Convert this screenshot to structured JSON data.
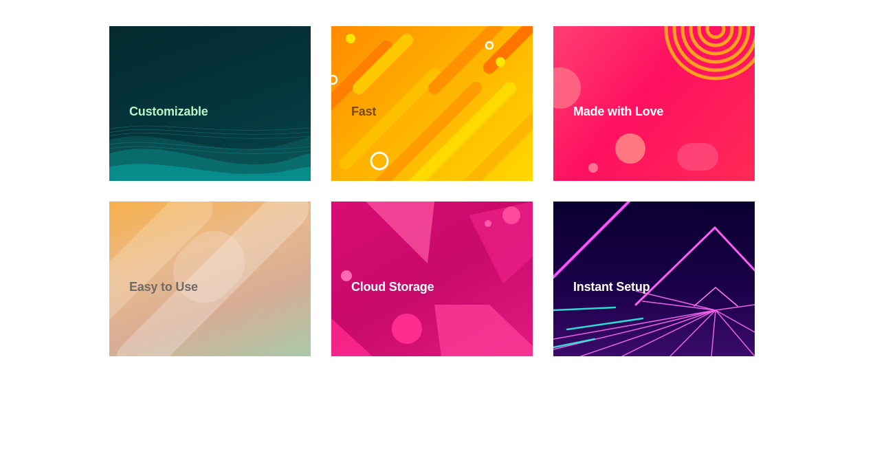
{
  "features": [
    {
      "title": "Customizable",
      "title_color": "#b9f5c6"
    },
    {
      "title": "Fast",
      "title_color": "#7a4a12"
    },
    {
      "title": "Made with Love",
      "title_color": "#ffffff"
    },
    {
      "title": "Easy to Use",
      "title_color": "#6f6a66"
    },
    {
      "title": "Cloud Storage",
      "title_color": "#ffffff"
    },
    {
      "title": "Instant Setup",
      "title_color": "#ffffff"
    }
  ]
}
